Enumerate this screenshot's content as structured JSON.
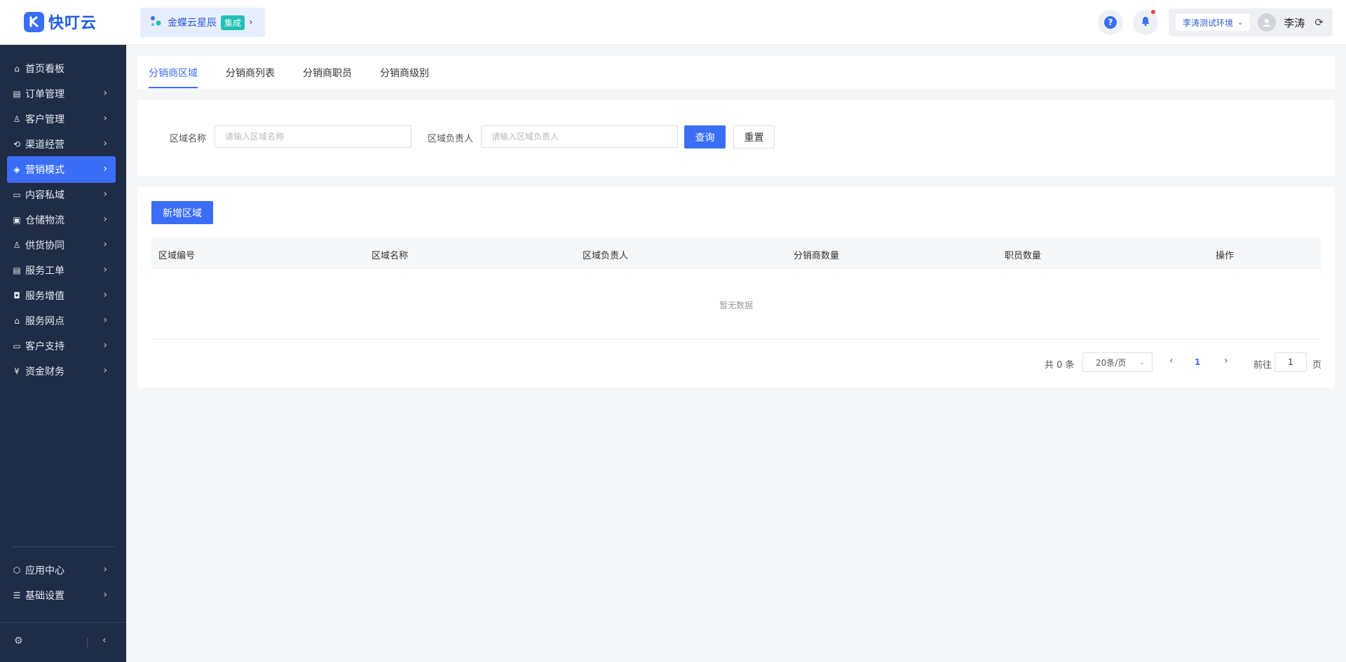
{
  "header": {
    "logo_text": "快叮云",
    "integration": {
      "label": "金蝶云星辰",
      "badge": "集成"
    },
    "env_label": "李涛测试环境",
    "username": "李涛"
  },
  "sidebar": {
    "items": [
      {
        "label": "首页看板",
        "icon": "home-icon"
      },
      {
        "label": "订单管理",
        "icon": "order-icon"
      },
      {
        "label": "客户管理",
        "icon": "user-icon"
      },
      {
        "label": "渠道经营",
        "icon": "channel-icon"
      },
      {
        "label": "营销模式",
        "icon": "tag-icon"
      },
      {
        "label": "内容私域",
        "icon": "image-icon"
      },
      {
        "label": "仓储物流",
        "icon": "warehouse-icon"
      },
      {
        "label": "供货协同",
        "icon": "supply-icon"
      },
      {
        "label": "服务工单",
        "icon": "ticket-icon"
      },
      {
        "label": "服务增值",
        "icon": "bag-icon"
      },
      {
        "label": "服务网点",
        "icon": "store-icon"
      },
      {
        "label": "客户支持",
        "icon": "support-icon"
      },
      {
        "label": "资金财务",
        "icon": "yuan-icon"
      }
    ],
    "bottom_items": [
      {
        "label": "应用中心",
        "icon": "cube-icon"
      },
      {
        "label": "基础设置",
        "icon": "settings-list-icon"
      }
    ],
    "active_index": 4
  },
  "tabs": [
    "分销商区域",
    "分销商列表",
    "分销商职员",
    "分销商级别"
  ],
  "filter": {
    "region_name_label": "区域名称",
    "region_name_placeholder": "请输入区域名称",
    "region_owner_label": "区域负责人",
    "region_owner_placeholder": "请输入区域负责人",
    "search_label": "查询",
    "reset_label": "重置"
  },
  "table": {
    "add_label": "新增区域",
    "columns": [
      "区域编号",
      "区域名称",
      "区域负责人",
      "分销商数量",
      "职员数量",
      "操作"
    ],
    "empty_text": "暂无数据"
  },
  "pagination": {
    "total_text": "共 0 条",
    "page_size": "20条/页",
    "current_page": "1",
    "goto_label": "前往",
    "goto_value": "1",
    "page_unit": "页"
  },
  "colors": {
    "primary": "#3a6ef6",
    "sidebar_bg": "#1f2c46",
    "badge": "#22c0b5"
  }
}
